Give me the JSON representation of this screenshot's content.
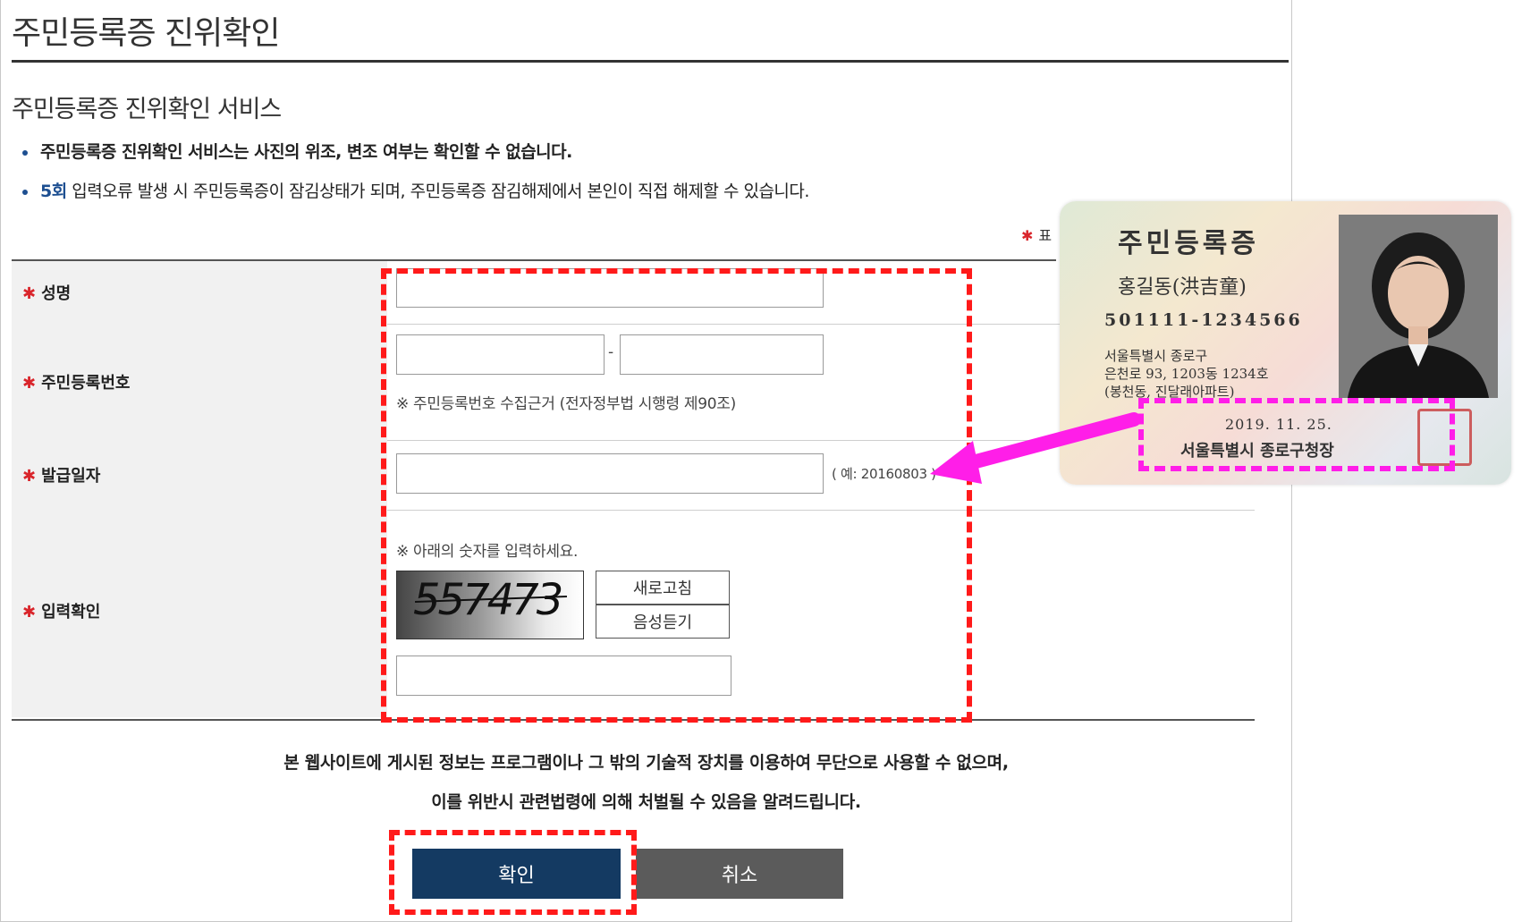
{
  "page": {
    "title": "주민등록증 진위확인",
    "section_title": "주민등록증 진위확인 서비스",
    "bullets": {
      "first": "주민등록증 진위확인 서비스는 사진의 위조, 변조 여부는 확인할 수 없습니다.",
      "second_highlight": "5회",
      "second_rest": " 입력오류 발생 시 주민등록증이 잠김상태가 되며, 주민등록증 잠김해제에서 본인이 직접 해제할 수 있습니다."
    },
    "required_marker": "✱",
    "required_note": "표"
  },
  "form": {
    "name_label": "성명",
    "rrn_label": "주민등록번호",
    "rrn_separator": "-",
    "rrn_note": "※ 주민등록번호 수집근거 (전자정부법 시행령 제90조)",
    "issue_date_label": "발급일자",
    "issue_date_hint": "( 예: 20160803 )",
    "captcha_label": "입력확인",
    "captcha_instruction": "※ 아래의 숫자를 입력하세요.",
    "captcha_value": "557473",
    "refresh_label": "새로고침",
    "audio_label": "음성듣기"
  },
  "notice": {
    "line1": "본 웹사이트에 게시된 정보는 프로그램이나 그 밖의 기술적 장치를 이용하여 무단으로 사용할 수 없으며,",
    "line2": "이를 위반시 관련법령에 의해 처벌될 수 있음을 알려드립니다."
  },
  "buttons": {
    "confirm": "확인",
    "cancel": "취소"
  },
  "id_card": {
    "title": "주민등록증",
    "name": "홍길동(洪吉童)",
    "number": "501111-1234566",
    "address_line1": "서울특별시 종로구",
    "address_line2": "은천로 93, 1203동 1234호",
    "address_line3": "(봉천동, 진달래아파트)",
    "issue_date": "2019. 11. 25.",
    "issuer": "서울특별시 종로구청장"
  },
  "colors": {
    "accent": "#1d4f91",
    "confirm_button": "#143a62",
    "cancel_button": "#5b5b5b",
    "required_star": "#d9252b",
    "annotation_red": "#ff1a1a",
    "annotation_magenta": "#ff1ee8"
  }
}
